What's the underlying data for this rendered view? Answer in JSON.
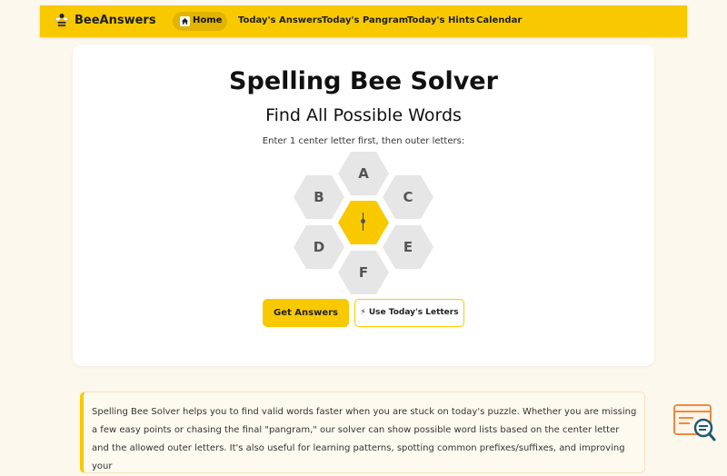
{
  "nav": {
    "logo_text": "BeeAnswers",
    "home_label": "Home",
    "links": [
      "Today's Answers",
      "Today's Pangram",
      "Today's Hints",
      "Calendar"
    ]
  },
  "main": {
    "title": "Spelling Bee Solver",
    "subtitle": "Find All Possible Words",
    "instruction": "Enter 1 center letter first, then outer letters:",
    "letters": {
      "top": "A",
      "upper_left": "B",
      "upper_right": "C",
      "center": "",
      "lower_left": "D",
      "lower_right": "E",
      "bottom": "F"
    },
    "primary_button": "Get Answers",
    "secondary_button": "⚡ Use Today's Letters"
  },
  "description": {
    "text": "Spelling Bee Solver helps you to find valid words faster when you are stuck on today's puzzle. Whether you are missing a few easy points or chasing the final \"pangram,\" our solver can show possible word lists based on the center letter and the allowed outer letters. It's also useful for learning patterns, spotting common prefixes/suffixes, and improving your"
  },
  "colors": {
    "accent": "#f9c900",
    "page_bg": "#fdf8ee",
    "hex_gray": "#e6e6e6"
  },
  "icons": {
    "logo": "bee-icon",
    "home": "home-icon",
    "widget": "search-magnifier-icon"
  }
}
